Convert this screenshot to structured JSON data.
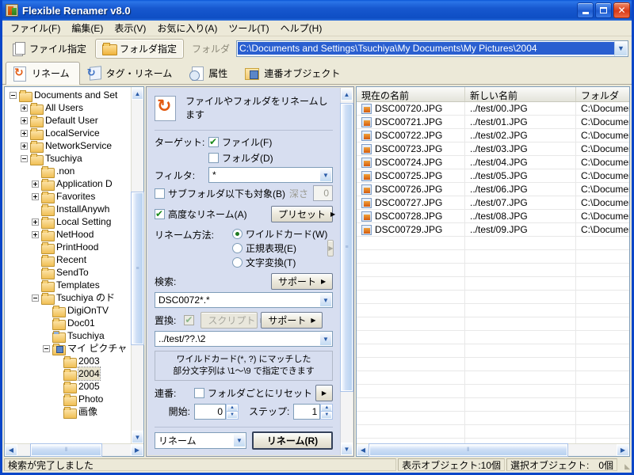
{
  "window": {
    "title": "Flexible Renamer v8.0",
    "app_icon": "app-icon",
    "buttons": {
      "minimize": "minimize-icon",
      "maximize": "maximize-icon",
      "close": "close-icon"
    }
  },
  "menubar": {
    "items": [
      {
        "label": "ファイル(F)"
      },
      {
        "label": "編集(E)"
      },
      {
        "label": "表示(V)"
      },
      {
        "label": "お気に入り(A)"
      },
      {
        "label": "ツール(T)"
      },
      {
        "label": "ヘルプ(H)"
      }
    ]
  },
  "toolbar": {
    "file_mode": "ファイル指定",
    "folder_mode": "フォルダ指定",
    "folder_label": "フォルダ",
    "path_value": "C:\\Documents and Settings\\Tsuchiya\\My Documents\\My Pictures\\2004"
  },
  "tabs": [
    {
      "label": "リネーム",
      "icon": "rename-icon",
      "active": true
    },
    {
      "label": "タグ・リネーム",
      "icon": "tag-rename-icon",
      "active": false
    },
    {
      "label": "属性",
      "icon": "attribute-icon",
      "active": false
    },
    {
      "label": "連番オブジェクト",
      "icon": "serial-object-icon",
      "active": false
    }
  ],
  "tree": {
    "nodes": [
      {
        "label": "Documents and Set",
        "indent": 0,
        "expander": "minus",
        "icon": "folder-icon",
        "selected": false
      },
      {
        "label": "All Users",
        "indent": 1,
        "expander": "plus",
        "icon": "folder-icon",
        "selected": false
      },
      {
        "label": "Default User",
        "indent": 1,
        "expander": "plus",
        "icon": "folder-icon",
        "selected": false
      },
      {
        "label": "LocalService",
        "indent": 1,
        "expander": "plus",
        "icon": "folder-icon",
        "selected": false
      },
      {
        "label": "NetworkService",
        "indent": 1,
        "expander": "plus",
        "icon": "folder-icon",
        "selected": false
      },
      {
        "label": "Tsuchiya",
        "indent": 1,
        "expander": "minus",
        "icon": "folder-icon",
        "selected": false
      },
      {
        "label": ".non",
        "indent": 2,
        "expander": "none",
        "icon": "folder-icon",
        "selected": false
      },
      {
        "label": "Application D",
        "indent": 2,
        "expander": "plus",
        "icon": "folder-icon",
        "selected": false
      },
      {
        "label": "Favorites",
        "indent": 2,
        "expander": "plus",
        "icon": "folder-icon",
        "selected": false
      },
      {
        "label": "InstallAnywh",
        "indent": 2,
        "expander": "none",
        "icon": "folder-icon",
        "selected": false
      },
      {
        "label": "Local Setting",
        "indent": 2,
        "expander": "plus",
        "icon": "folder-icon",
        "selected": false
      },
      {
        "label": "NetHood",
        "indent": 2,
        "expander": "plus",
        "icon": "folder-icon",
        "selected": false
      },
      {
        "label": "PrintHood",
        "indent": 2,
        "expander": "none",
        "icon": "folder-icon",
        "selected": false
      },
      {
        "label": "Recent",
        "indent": 2,
        "expander": "none",
        "icon": "folder-icon",
        "selected": false
      },
      {
        "label": "SendTo",
        "indent": 2,
        "expander": "none",
        "icon": "folder-icon",
        "selected": false
      },
      {
        "label": "Templates",
        "indent": 2,
        "expander": "none",
        "icon": "folder-icon",
        "selected": false
      },
      {
        "label": "Tsuchiya のド",
        "indent": 2,
        "expander": "minus",
        "icon": "folder-icon",
        "selected": false
      },
      {
        "label": "DigiOnTV",
        "indent": 3,
        "expander": "none",
        "icon": "folder-icon",
        "selected": false
      },
      {
        "label": "Doc01",
        "indent": 3,
        "expander": "none",
        "icon": "folder-icon",
        "selected": false
      },
      {
        "label": "Tsuchiya",
        "indent": 3,
        "expander": "none",
        "icon": "special-folder-icon",
        "selected": false
      },
      {
        "label": "マイ ピクチャ",
        "indent": 3,
        "expander": "minus",
        "icon": "pictures-folder-icon",
        "selected": false
      },
      {
        "label": "2003",
        "indent": 4,
        "expander": "none",
        "icon": "folder-icon",
        "selected": false
      },
      {
        "label": "2004",
        "indent": 4,
        "expander": "none",
        "icon": "folder-icon",
        "selected": true
      },
      {
        "label": "2005",
        "indent": 4,
        "expander": "none",
        "icon": "folder-icon",
        "selected": false
      },
      {
        "label": "Photo",
        "indent": 4,
        "expander": "none",
        "icon": "folder-icon",
        "selected": false
      },
      {
        "label": "画像",
        "indent": 4,
        "expander": "none",
        "icon": "folder-icon",
        "selected": false
      }
    ]
  },
  "options": {
    "heading": "ファイルやフォルダをリネームします",
    "target_label": "ターゲット:",
    "target_file": {
      "label": "ファイル(F)",
      "checked": true
    },
    "target_folder": {
      "label": "フォルダ(D)",
      "checked": false
    },
    "filter_label": "フィルタ:",
    "filter_value": "*",
    "subfolder": {
      "label": "サブフォルダ以下も対象(B)",
      "checked": false
    },
    "depth_label": "深さ",
    "depth_value": "0",
    "advanced": {
      "label": "高度なリネーム(A)",
      "checked": true
    },
    "preset_button": "プリセット",
    "method_label": "リネーム方法:",
    "method_wildcard": {
      "label": "ワイルドカード(W)",
      "selected": true
    },
    "method_regex": {
      "label": "正規表現(E)",
      "selected": false
    },
    "method_convert": {
      "label": "文字変換(T)",
      "selected": false
    },
    "search_label": "検索:",
    "search_support_button": "サポート",
    "search_value": "DSC0072*.*",
    "replace_label": "置換:",
    "replace_checked": true,
    "script_button": "スクリプト",
    "replace_support_button": "サポート",
    "replace_value": "../test/??.\\2",
    "hint_line1": "ワイルドカード(*, ?) にマッチした",
    "hint_line2": "部分文字列は \\1～\\9 で指定できます",
    "serial_label": "連番:",
    "reset_per_folder": {
      "label": "フォルダごとにリセット",
      "checked": false
    },
    "start_label": "開始:",
    "start_value": "0",
    "step_label": "ステップ:",
    "step_value": "1",
    "action_select": "リネーム",
    "run_button": "リネーム(R)"
  },
  "filelist": {
    "columns": [
      "現在の名前",
      "新しい名前",
      "フォルダ"
    ],
    "rows": [
      {
        "current": "DSC00720.JPG",
        "new": "../test/00.JPG",
        "folder": "C:\\Documen"
      },
      {
        "current": "DSC00721.JPG",
        "new": "../test/01.JPG",
        "folder": "C:\\Documen"
      },
      {
        "current": "DSC00722.JPG",
        "new": "../test/02.JPG",
        "folder": "C:\\Documen"
      },
      {
        "current": "DSC00723.JPG",
        "new": "../test/03.JPG",
        "folder": "C:\\Documen"
      },
      {
        "current": "DSC00724.JPG",
        "new": "../test/04.JPG",
        "folder": "C:\\Documen"
      },
      {
        "current": "DSC00725.JPG",
        "new": "../test/05.JPG",
        "folder": "C:\\Documen"
      },
      {
        "current": "DSC00726.JPG",
        "new": "../test/06.JPG",
        "folder": "C:\\Documen"
      },
      {
        "current": "DSC00727.JPG",
        "new": "../test/07.JPG",
        "folder": "C:\\Documen"
      },
      {
        "current": "DSC00728.JPG",
        "new": "../test/08.JPG",
        "folder": "C:\\Documen"
      },
      {
        "current": "DSC00729.JPG",
        "new": "../test/09.JPG",
        "folder": "C:\\Documen"
      }
    ]
  },
  "statusbar": {
    "message": "検索が完了しました",
    "shown_label": "表示オブジェクト:",
    "shown_value": "10個",
    "selected_label": "選択オブジェクト:",
    "selected_value": "0個"
  },
  "colors": {
    "titlebar_blue": "#0a46c8",
    "panel_bg": "#ece9d8",
    "options_bg": "#d7def0",
    "selection_blue": "#2a5fd0",
    "tree_selection": "#e8e3cd"
  }
}
